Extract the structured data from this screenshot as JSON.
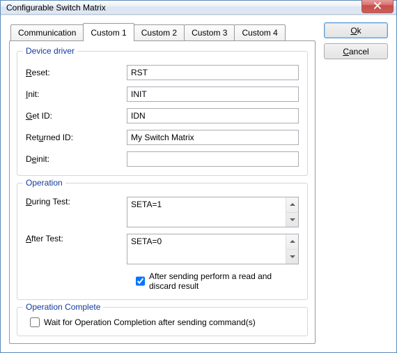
{
  "window": {
    "title": "Configurable Switch Matrix"
  },
  "buttons": {
    "ok": "Ok",
    "ok_ul": "O",
    "cancel": "Cancel",
    "cancel_ul": "C"
  },
  "tabs": {
    "communication": "Communication",
    "custom1": "Custom 1",
    "custom2": "Custom 2",
    "custom3": "Custom 3",
    "custom4": "Custom 4",
    "active": "custom1"
  },
  "groups": {
    "device_driver": "Device driver",
    "operation": "Operation",
    "operation_complete": "Operation Complete"
  },
  "labels": {
    "reset_ul": "R",
    "reset_rest": "eset:",
    "init_ul": "I",
    "init_rest": "nit:",
    "getid_ul": "G",
    "getid_rest": "et ID:",
    "returnedid_pre": "Ret",
    "returnedid_ul": "u",
    "returnedid_post": "rned ID:",
    "deinit_pre": "D",
    "deinit_ul": "e",
    "deinit_post": "init:",
    "during_ul": "D",
    "during_rest": "uring Test:",
    "after_ul": "A",
    "after_rest": "fter Test:",
    "after_sending": "After sending perform a read and discard result",
    "wait_op": "Wait for Operation Completion after sending command(s)"
  },
  "values": {
    "reset": "RST",
    "init": "INIT",
    "getid": "IDN",
    "returned_id": "My Switch Matrix",
    "deinit": "",
    "during_test": "SETA=1",
    "after_test": "SETA=0",
    "after_sending_checked": true,
    "wait_op_checked": false
  }
}
